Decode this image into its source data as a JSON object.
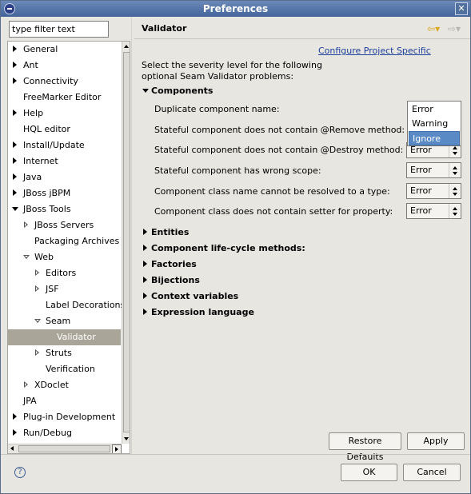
{
  "window": {
    "title": "Preferences"
  },
  "filter": {
    "value": "type filter text"
  },
  "tree": {
    "items": [
      {
        "label": "General",
        "expander": "collapsed"
      },
      {
        "label": "Ant",
        "expander": "collapsed"
      },
      {
        "label": "Connectivity",
        "expander": "collapsed"
      },
      {
        "label": "FreeMarker Editor",
        "expander": "none"
      },
      {
        "label": "Help",
        "expander": "collapsed"
      },
      {
        "label": "HQL editor",
        "expander": "none"
      },
      {
        "label": "Install/Update",
        "expander": "collapsed"
      },
      {
        "label": "Internet",
        "expander": "collapsed"
      },
      {
        "label": "Java",
        "expander": "collapsed"
      },
      {
        "label": "JBoss jBPM",
        "expander": "collapsed"
      },
      {
        "label": "JBoss Tools",
        "expander": "expanded"
      },
      {
        "label": "JBoss Servers",
        "expander": "collapsed"
      },
      {
        "label": "Packaging Archives",
        "expander": "none"
      },
      {
        "label": "Web",
        "expander": "expanded"
      },
      {
        "label": "Editors",
        "expander": "collapsed"
      },
      {
        "label": "JSF",
        "expander": "collapsed"
      },
      {
        "label": "Label Decorations",
        "expander": "none"
      },
      {
        "label": "Seam",
        "expander": "expanded"
      },
      {
        "label": "Validator",
        "expander": "none",
        "selected": true
      },
      {
        "label": "Struts",
        "expander": "collapsed"
      },
      {
        "label": "Verification",
        "expander": "none"
      },
      {
        "label": "XDoclet",
        "expander": "collapsed"
      },
      {
        "label": "JPA",
        "expander": "none"
      },
      {
        "label": "Plug-in Development",
        "expander": "collapsed"
      },
      {
        "label": "Run/Debug",
        "expander": "collapsed"
      }
    ]
  },
  "page": {
    "title": "Validator",
    "config_link": "Configure Project Specific",
    "description_line1": "Select the severity level for the following",
    "description_line2": "optional Seam Validator problems:",
    "sections": {
      "components": "Components",
      "entities": "Entities",
      "lifecycle": "Component life-cycle methods:",
      "factories": "Factories",
      "bijections": "Bijections",
      "context_variables": "Context variables",
      "expression_language": "Expression language"
    },
    "rows": [
      {
        "label": "Duplicate component name:",
        "value": ""
      },
      {
        "label": "Stateful component does not contain @Remove method:",
        "value": ""
      },
      {
        "label": "Stateful component does not contain @Destroy method:",
        "value": "Error"
      },
      {
        "label": "Stateful component has wrong scope:",
        "value": "Error"
      },
      {
        "label": "Component class name cannot be resolved to a type:",
        "value": "Error"
      },
      {
        "label": "Component class does not contain setter for property:",
        "value": "Error"
      }
    ],
    "popup_options": [
      "Error",
      "Warning",
      "Ignore"
    ],
    "popup_highlighted": "Ignore",
    "restore_defaults": "Restore Defaults",
    "apply": "Apply"
  },
  "footer": {
    "ok": "OK",
    "cancel": "Cancel"
  },
  "icons": {
    "app": "eclipse-icon",
    "close": "close-icon",
    "back": "back-arrow-icon",
    "forward": "forward-arrow-icon",
    "help": "help-icon"
  }
}
